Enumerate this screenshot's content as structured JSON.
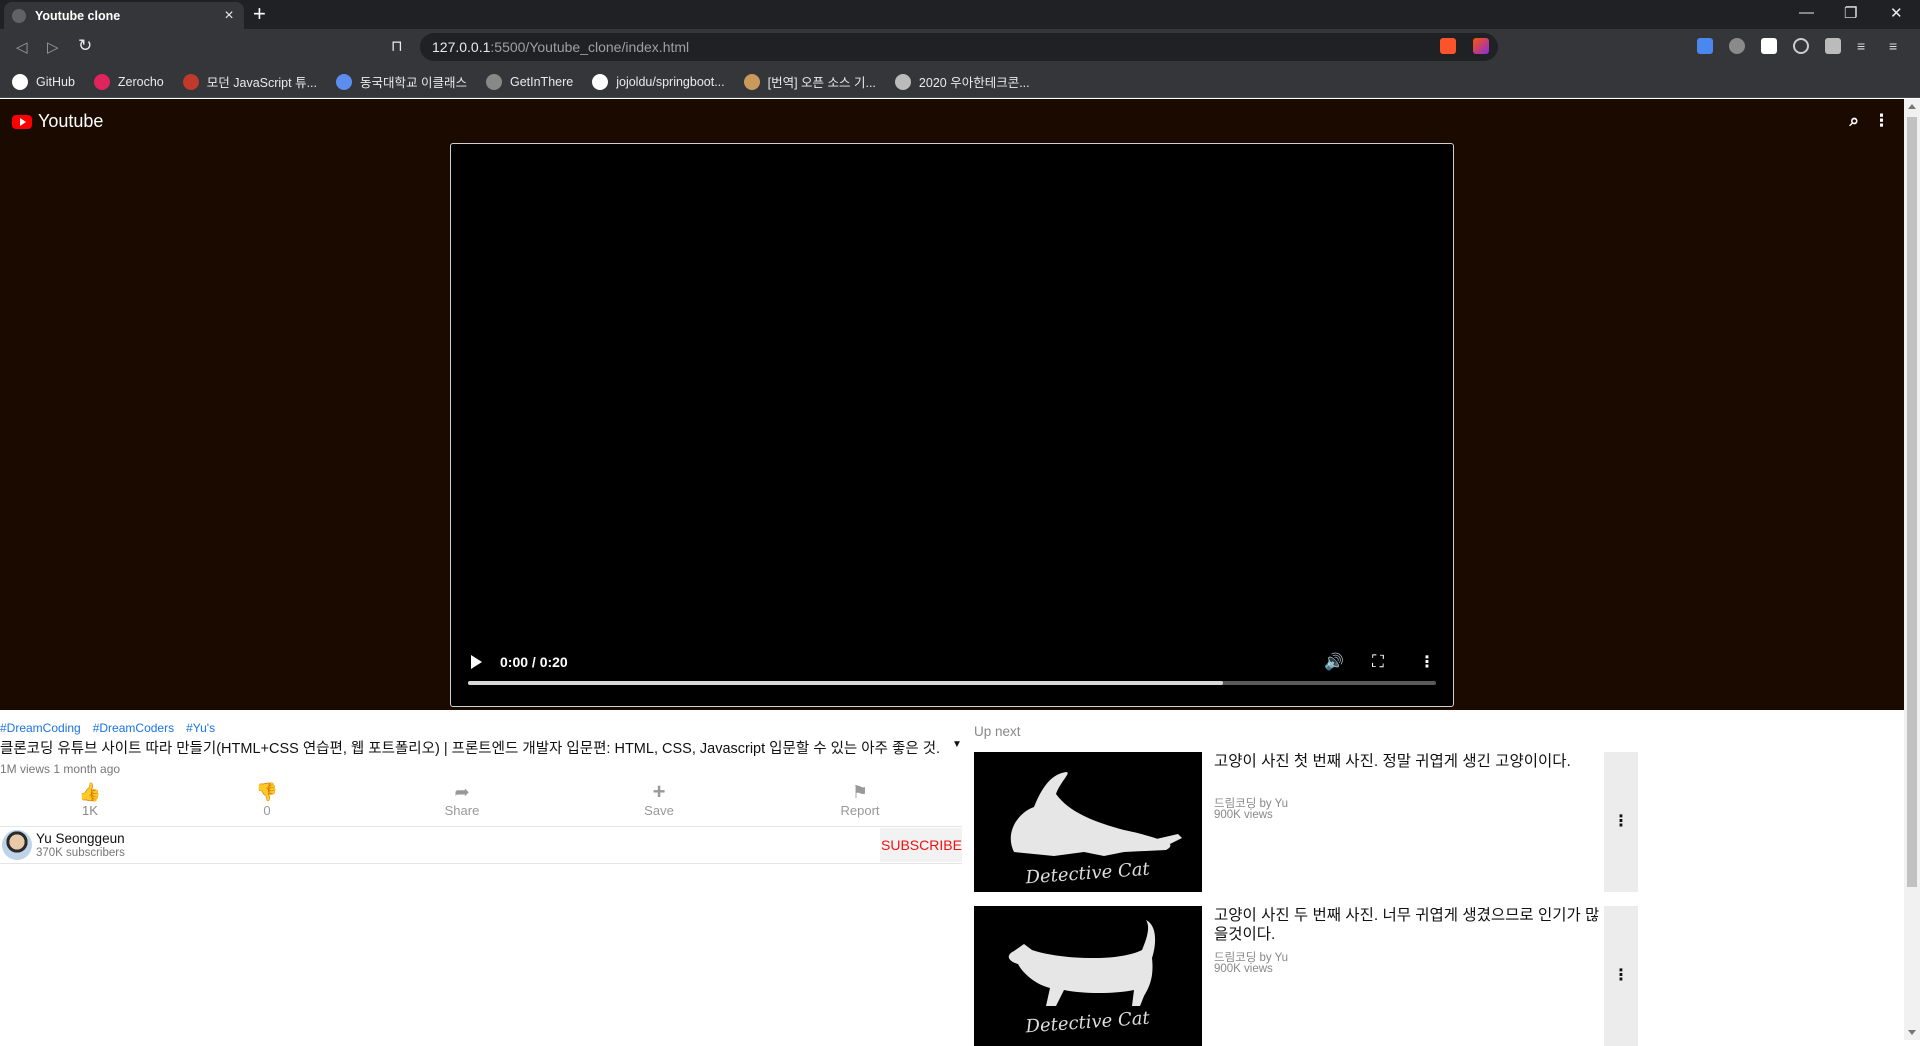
{
  "browser": {
    "tab_title": "Youtube clone",
    "tab_close": "×",
    "new_tab": "+",
    "url_host": "127.0.0.1",
    "url_path": ":5500/Youtube_clone/index.html",
    "window_controls": {
      "minimize": "—",
      "restore": "❐",
      "close": "✕"
    },
    "bookmarks": [
      {
        "label": "GitHub",
        "color": "#ffffff"
      },
      {
        "label": "Zerocho",
        "color": "#e0245e"
      },
      {
        "label": "모던 JavaScript 튜...",
        "color": "#c0392b"
      },
      {
        "label": "동국대학교 이클래스",
        "color": "#5b8def"
      },
      {
        "label": "GetInThere",
        "color": "#888888"
      },
      {
        "label": "jojoldu/springboot...",
        "color": "#ffffff"
      },
      {
        "label": "[번역] 오픈 소스 기...",
        "color": "#c99a5b"
      },
      {
        "label": "2020 우아한테크콘...",
        "color": "#bbbbbb"
      }
    ]
  },
  "header": {
    "logo_text": "Youtube",
    "search_icon": "⌕",
    "more_icon": "⋮",
    "accent": "#ff0000",
    "background": "#1a0a00"
  },
  "video": {
    "time": "0:00 / 0:20",
    "progress": 0.78,
    "volume_icon": "🔊",
    "fullscreen_icon": "⛶",
    "more_icon": "⋮"
  },
  "info": {
    "hashtags": [
      "#DreamCoding",
      "#DreamCoders",
      "#Yu's"
    ],
    "title": "클론코딩 유튜브 사이트 따라 만들기(HTML+CSS 연습편, 웹 포트폴리오) | 프론트엔드 개발자 입문편: HTML, CSS, Javascript 입문할 수 있는 아주 좋은 것.",
    "expand_icon": "▼",
    "meta": "1M views 1 month ago",
    "actions": [
      {
        "icon": "👍",
        "label": "1K"
      },
      {
        "icon": "👎",
        "label": "0"
      },
      {
        "icon": "➦",
        "label": "Share"
      },
      {
        "icon": "+",
        "label": "Save"
      },
      {
        "icon": "⚑",
        "label": "Report"
      }
    ],
    "channel": {
      "name": "Yu Seonggeun",
      "subscribers": "370K subscribers",
      "subscribe_label": "Subscribe"
    }
  },
  "upnext": {
    "label": "Up next",
    "items": [
      {
        "title": "고양이 사진 첫 번째 사진. 정말 귀엽게 생긴 고양이이다.",
        "by": "드림코딩 by Yu",
        "views": "900K views",
        "thumb_text": "Detective Cat",
        "more_icon": "⋮"
      },
      {
        "title": "고양이 사진 두 번째 사진. 너무 귀엽게 생겼으므로 인기가 많을것이다.",
        "by": "드림코딩 by Yu",
        "views": "900K views",
        "thumb_text": "Detective Cat",
        "more_icon": "⋮"
      }
    ]
  }
}
